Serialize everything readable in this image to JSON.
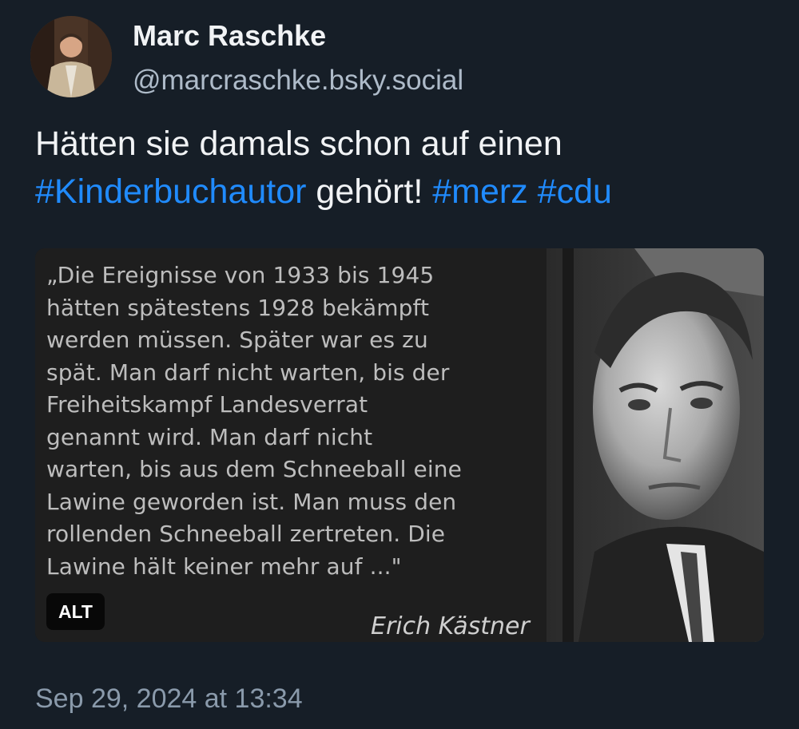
{
  "author": {
    "name": "Marc Raschke",
    "handle": "@marcraschke.bsky.social"
  },
  "post": {
    "text_before": "Hätten sie damals schon auf einen ",
    "hashtag_1": "#Kinderbuchautor",
    "text_middle": " gehört! ",
    "hashtag_2": "#merz",
    "text_space": " ",
    "hashtag_3": "#cdu",
    "timestamp": "Sep 29, 2024 at 13:34"
  },
  "media": {
    "quote": "„Die Ereignisse von 1933 bis 1945\nhätten spätestens 1928 bekämpft\nwerden müssen. Später war es zu\nspät. Man darf nicht warten, bis der\nFreiheitskampf Landesverrat\ngenannt wird. Man darf nicht\nwarten, bis aus dem Schneeball eine\nLawine geworden ist. Man muss den\nrollenden Schneeball zertreten. Die\nLawine hält keiner mehr auf ...\"",
    "quote_author": "Erich Kästner",
    "alt_label": "ALT"
  },
  "colors": {
    "background": "#161e27",
    "hashtag": "#208bfe",
    "handle": "#aebbc9",
    "timestamp": "#8a9aab"
  }
}
